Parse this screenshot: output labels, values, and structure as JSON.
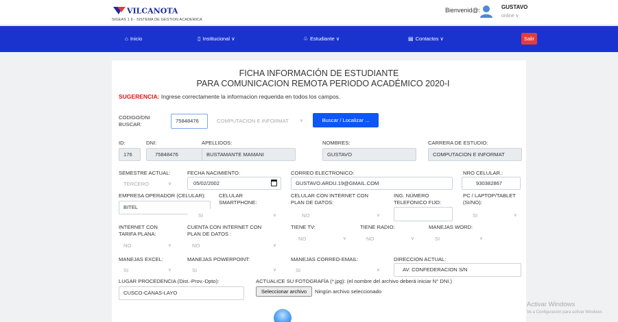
{
  "header": {
    "logo_text": "VILCANOTA",
    "subtitle": "SIGEAS 1 II - SISTEMA DE GESTION ACADEMICA",
    "welcome": "Bienvenid@:",
    "username": "GUSTAVO",
    "status": "online ∨"
  },
  "nav": {
    "items": [
      {
        "icon": "home-icon",
        "label": "Inicio"
      },
      {
        "icon": "building-icon",
        "label": "Institucional ∨"
      },
      {
        "icon": "student-icon",
        "label": "Estudiante ∨"
      },
      {
        "icon": "contact-icon",
        "label": "Contactos ∨"
      }
    ],
    "logout": "Salir"
  },
  "form": {
    "title1": "FICHA INFORMACIÓN DE ESTUDIANTE",
    "title2": "PARA COMUNICACION REMOTA PERIODO ACADÉMICO 2020-I",
    "hint_label": "SUGERENCIA:",
    "hint_text": " Ingrese correctamente la informacion requerida en todos los campos.",
    "search_label_1": "CODIGO/DNI",
    "search_label_2": "BUSCAR:",
    "search_value": "75848476",
    "search_career": "COMPUTACION E INFORMAT",
    "search_button": "Buscar / Localizar ...",
    "labels": {
      "id": "ID:",
      "dni": "DNI:",
      "apellidos": "APELLIDOS:",
      "nombres": "NOMBRES:",
      "carrera": "CARRERA DE ESTUDIO:",
      "semestre": "SEMESTRE ACTUAL:",
      "fecha": "FECHA NACIMIENTO:",
      "correo": "CORREO ELECTRONICO:",
      "celular": "NRO CELULAR.:",
      "operador": "EMPRESA OPERADOR (CELULAR):",
      "smart_1": "CELULAR",
      "smart_2": "SMARTPHONE:",
      "celinternet_1": "CELULAR CON INTERNET CON",
      "celinternet_2": "PLAN DE DATOS:",
      "fijo_1": "ING. NÚMERO",
      "fijo_2": "TELEFONICO FIJO:",
      "pc_1": "PC / LAPTOP/TABLET",
      "pc_2": "(SI/NO):",
      "internet_1": "INTERNET CON",
      "internet_2": "TARIFA PLANA:",
      "cuenta_1": "CUENTA CON INTERNET CON",
      "cuenta_2": "PLAN DE DATOS :",
      "tv": "TIENE TV:",
      "radio": "TIENE RADIO:",
      "word": "MANEJAS WORD:",
      "excel": "MANEJAS EXCEL:",
      "ppt": "MANEJAS POWERPOINT:",
      "email": "MANEJAS CORREO-EMAIL:",
      "direccion": "DIRECCION ACTUAL:",
      "lugar": "LUGAR PROCEDENCIA (Dist.-Prov.-Dpto):",
      "foto": "ACTUALICE SU FOTOGRAFÍA (*.jpg): (el nombre del archivo deberá iniciar N° DNI.)"
    },
    "values": {
      "id": "176",
      "dni": "75848476",
      "apellidos": "BUSTAMANTE  MAMANI",
      "nombres": "GUSTAVO",
      "carrera": "COMPUTACION E INFORMAT",
      "semestre": "TERCERO",
      "fecha": "05/02/2002",
      "correo": "GUSTAVO.ARDU.19@GMAIL.COM",
      "celular": "930382867",
      "operador": "BITEL",
      "smart": "SI",
      "celinternet": "NO",
      "fijo": "",
      "pc": "SI",
      "internet": "NO",
      "cuenta": "NO",
      "tv": "NO",
      "radio": "NO",
      "word": "SI",
      "excel": "SI",
      "ppt": "SI",
      "email": "SI",
      "direccion": "AV. CONFEDERACION S/N",
      "lugar": "CUSCO-CANAS-LAYO"
    },
    "file_button": "Seleccionar archivo",
    "file_status": "Ningún archivo seleccionado"
  },
  "watermark": {
    "line1": "Activar Windows",
    "line2": "Ve a Configuración para activar Windows"
  },
  "colors": {
    "nav": "#1b33ce",
    "primary_button": "#0f56f5",
    "logout": "#e93a3a",
    "hint": "#e31313"
  }
}
